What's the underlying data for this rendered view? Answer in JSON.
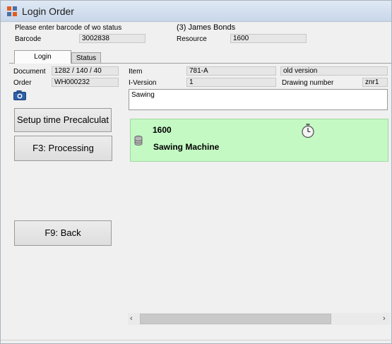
{
  "window": {
    "title": "Login Order"
  },
  "header": {
    "prompt": "Please enter barcode of wo status",
    "user": "(3) James Bonds",
    "barcode_label": "Barcode",
    "barcode_value": "3002838",
    "resource_label": "Resource",
    "resource_value": "1600"
  },
  "tabs": [
    {
      "label": "Login",
      "active": true
    },
    {
      "label": "Status",
      "active": false
    }
  ],
  "details": {
    "document_label": "Document",
    "document_value": "1282 / 140 / 40",
    "order_label": "Order",
    "order_value": "WH000232",
    "item_label": "Item",
    "item_value": "781-A",
    "item_version_text": "old version",
    "iversion_label": "I-Version",
    "iversion_value": "1",
    "drawing_label": "Drawing number",
    "drawing_value": "znr1",
    "note": "Sawing"
  },
  "buttons": {
    "setup": "Setup time Precalculat",
    "processing": "F3: Processing",
    "back": "F9: Back"
  },
  "operation": {
    "code": "1600",
    "name": "Sawing Machine",
    "background_color": "#c4f9c4"
  },
  "icons": {
    "app": "app-logo-icon",
    "camera": "camera-icon",
    "database": "database-icon",
    "timer": "stopwatch-icon"
  }
}
